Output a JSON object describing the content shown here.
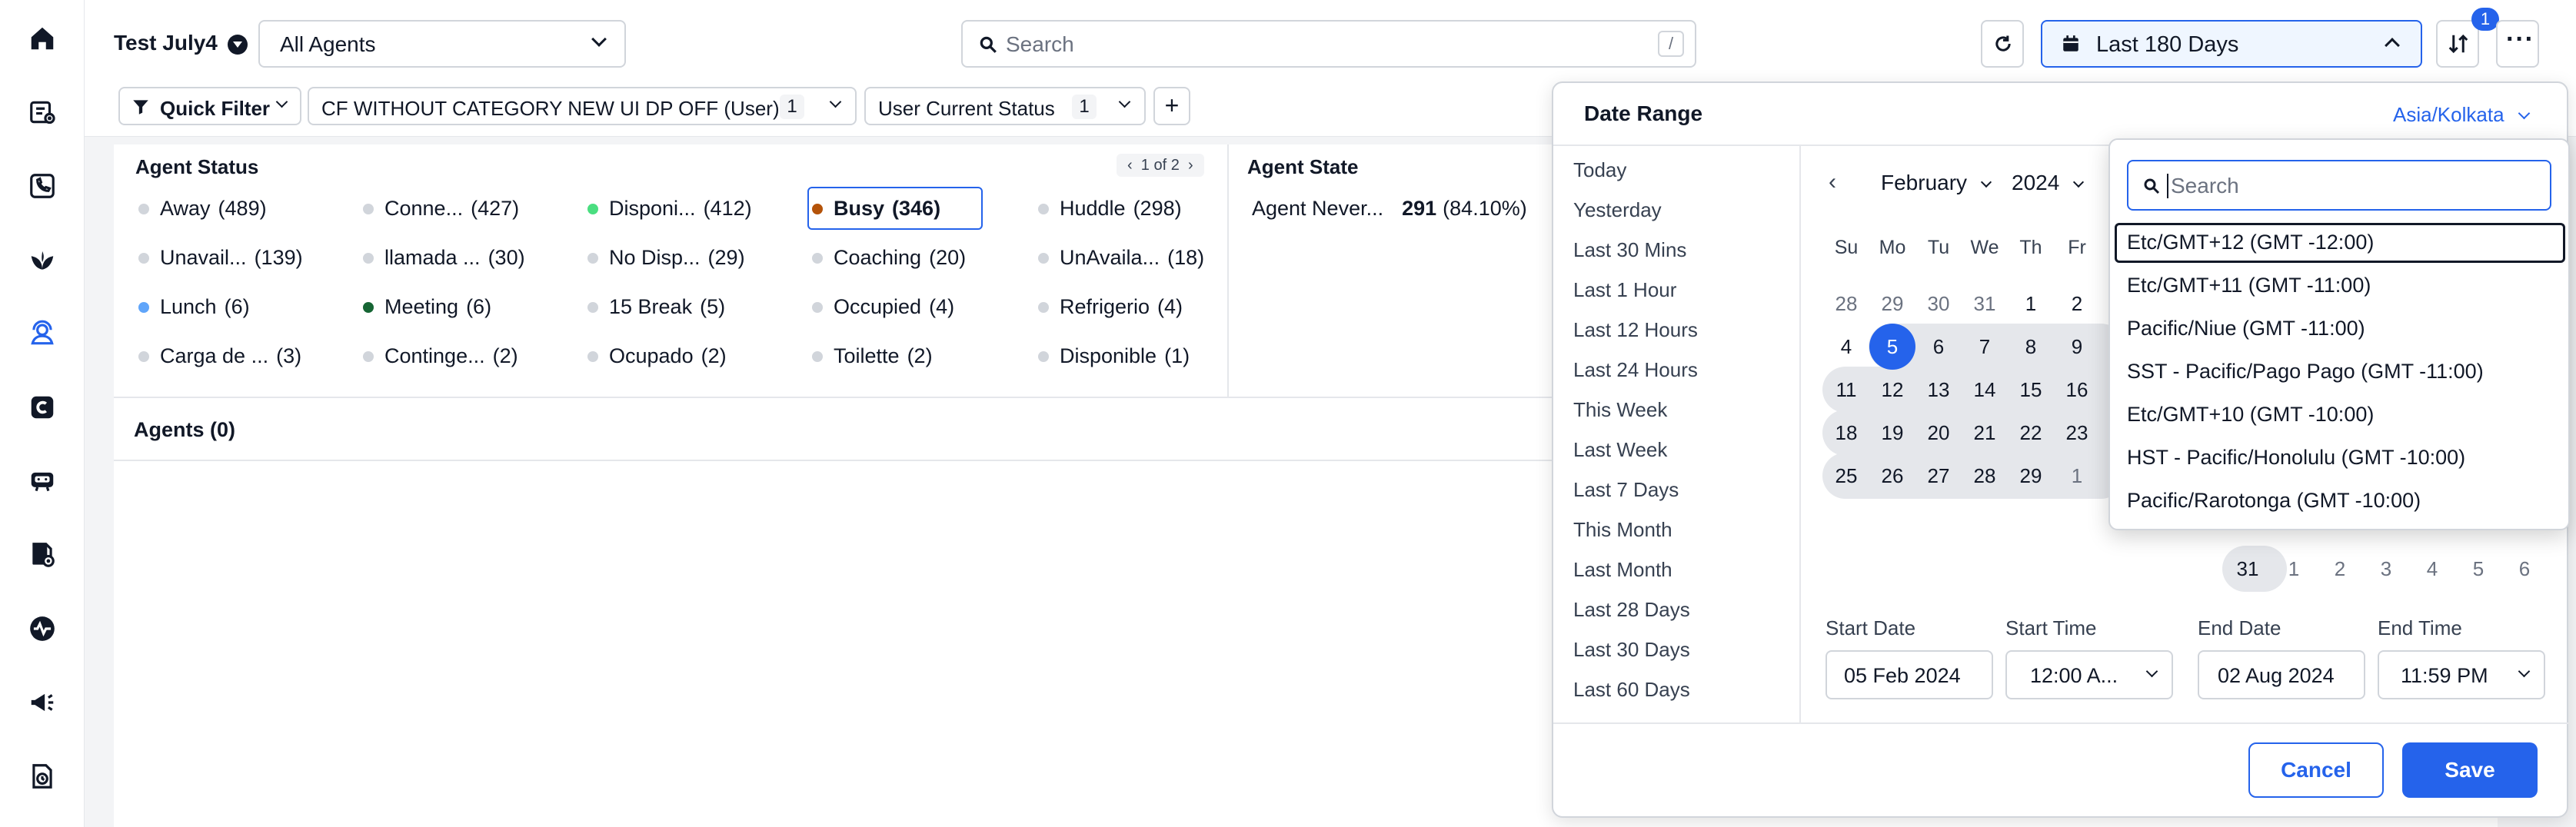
{
  "nav": {
    "icons": [
      "home-icon",
      "new-ticket-icon",
      "phone-book-icon",
      "plant-icon",
      "agent-icon",
      "c-badge-icon",
      "chat-bot-icon",
      "report-view-icon",
      "activity-icon",
      "campaign-icon",
      "history-icon"
    ]
  },
  "header": {
    "workspace": "Test July4",
    "agents_select": "All Agents",
    "search_placeholder": "Search",
    "search_shortcut": "/",
    "date_range": "Last 180 Days",
    "sort_badge": "1"
  },
  "filters": {
    "quick_filter": "Quick Filter",
    "chips": [
      {
        "label": "CF WITHOUT CATEGORY NEW UI DP OFF (User)",
        "count": "1"
      },
      {
        "label": "User Current Status",
        "count": "1"
      }
    ],
    "add": "+"
  },
  "agent_status": {
    "title": "Agent Status",
    "pager": "1 of 2",
    "items": [
      {
        "label": "Away",
        "count": "(489)",
        "color": "#d1d5db"
      },
      {
        "label": "Conne...",
        "count": "(427)",
        "color": "#d1d5db"
      },
      {
        "label": "Disponi...",
        "count": "(412)",
        "color": "#4ade80"
      },
      {
        "label": "Busy",
        "count": "(346)",
        "color": "#b45309"
      },
      {
        "label": "Huddle",
        "count": "(298)",
        "color": "#d1d5db"
      },
      {
        "label": "Unavail...",
        "count": "(139)",
        "color": "#d1d5db"
      },
      {
        "label": "llamada ...",
        "count": "(30)",
        "color": "#d1d5db"
      },
      {
        "label": "No Disp...",
        "count": "(29)",
        "color": "#d1d5db"
      },
      {
        "label": "Coaching",
        "count": "(20)",
        "color": "#d1d5db"
      },
      {
        "label": "UnAvaila...",
        "count": "(18)",
        "color": "#d1d5db"
      },
      {
        "label": "Lunch",
        "count": "(6)",
        "color": "#60a5fa"
      },
      {
        "label": "Meeting",
        "count": "(6)",
        "color": "#166534"
      },
      {
        "label": "15 Break",
        "count": "(5)",
        "color": "#d1d5db"
      },
      {
        "label": "Occupied",
        "count": "(4)",
        "color": "#d1d5db"
      },
      {
        "label": "Refrigerio",
        "count": "(4)",
        "color": "#d1d5db"
      },
      {
        "label": "Carga de ...",
        "count": "(3)",
        "color": "#d1d5db"
      },
      {
        "label": "Continge...",
        "count": "(2)",
        "color": "#d1d5db"
      },
      {
        "label": "Ocupado",
        "count": "(2)",
        "color": "#d1d5db"
      },
      {
        "label": "Toilette",
        "count": "(2)",
        "color": "#d1d5db"
      },
      {
        "label": "Disponible",
        "count": "(1)",
        "color": "#d1d5db"
      }
    ]
  },
  "agent_state": {
    "title": "Agent State",
    "label": "Agent Never...",
    "value": "291",
    "pct": "(84.10%)"
  },
  "agents": {
    "title": "Agents (0)"
  },
  "date_range": {
    "title": "Date Range",
    "timezone": "Asia/Kolkata",
    "presets": [
      "Today",
      "Yesterday",
      "Last 30 Mins",
      "Last 1 Hour",
      "Last 12 Hours",
      "Last 24 Hours",
      "This Week",
      "Last Week",
      "Last 7 Days",
      "This Month",
      "Last Month",
      "Last 28 Days",
      "Last 30 Days",
      "Last 60 Days"
    ],
    "month": "February",
    "year": "2024",
    "weekdays": [
      "Su",
      "Mo",
      "Tu",
      "We",
      "Th",
      "Fr"
    ],
    "weeks": [
      [
        "28",
        "29",
        "30",
        "31",
        "1",
        "2"
      ],
      [
        "4",
        "5",
        "6",
        "7",
        "8",
        "9"
      ],
      [
        "11",
        "12",
        "13",
        "14",
        "15",
        "16"
      ],
      [
        "18",
        "19",
        "20",
        "21",
        "22",
        "23"
      ],
      [
        "25",
        "26",
        "27",
        "28",
        "29",
        "1"
      ]
    ],
    "second_month_row": [
      "31",
      "1",
      "2",
      "3",
      "4",
      "5",
      "6"
    ],
    "start_date_label": "Start Date",
    "start_date": "05 Feb 2024",
    "start_time_label": "Start Time",
    "start_time": "12:00 A...",
    "end_date_label": "End Date",
    "end_date": "02 Aug 2024",
    "end_time_label": "End Time",
    "end_time": "11:59 PM",
    "cancel": "Cancel",
    "save": "Save"
  },
  "timezone_dropdown": {
    "search_placeholder": "Search",
    "options": [
      "Etc/GMT+12 (GMT -12:00)",
      "Etc/GMT+11 (GMT -11:00)",
      "Pacific/Niue (GMT -11:00)",
      "SST - Pacific/Pago Pago (GMT -11:00)",
      "Etc/GMT+10 (GMT -10:00)",
      "HST - Pacific/Honolulu (GMT -10:00)",
      "Pacific/Rarotonga (GMT -10:00)"
    ]
  },
  "colors": {
    "accent": "#2563eb",
    "range": "#e5e7eb",
    "border": "#d1d5db"
  }
}
